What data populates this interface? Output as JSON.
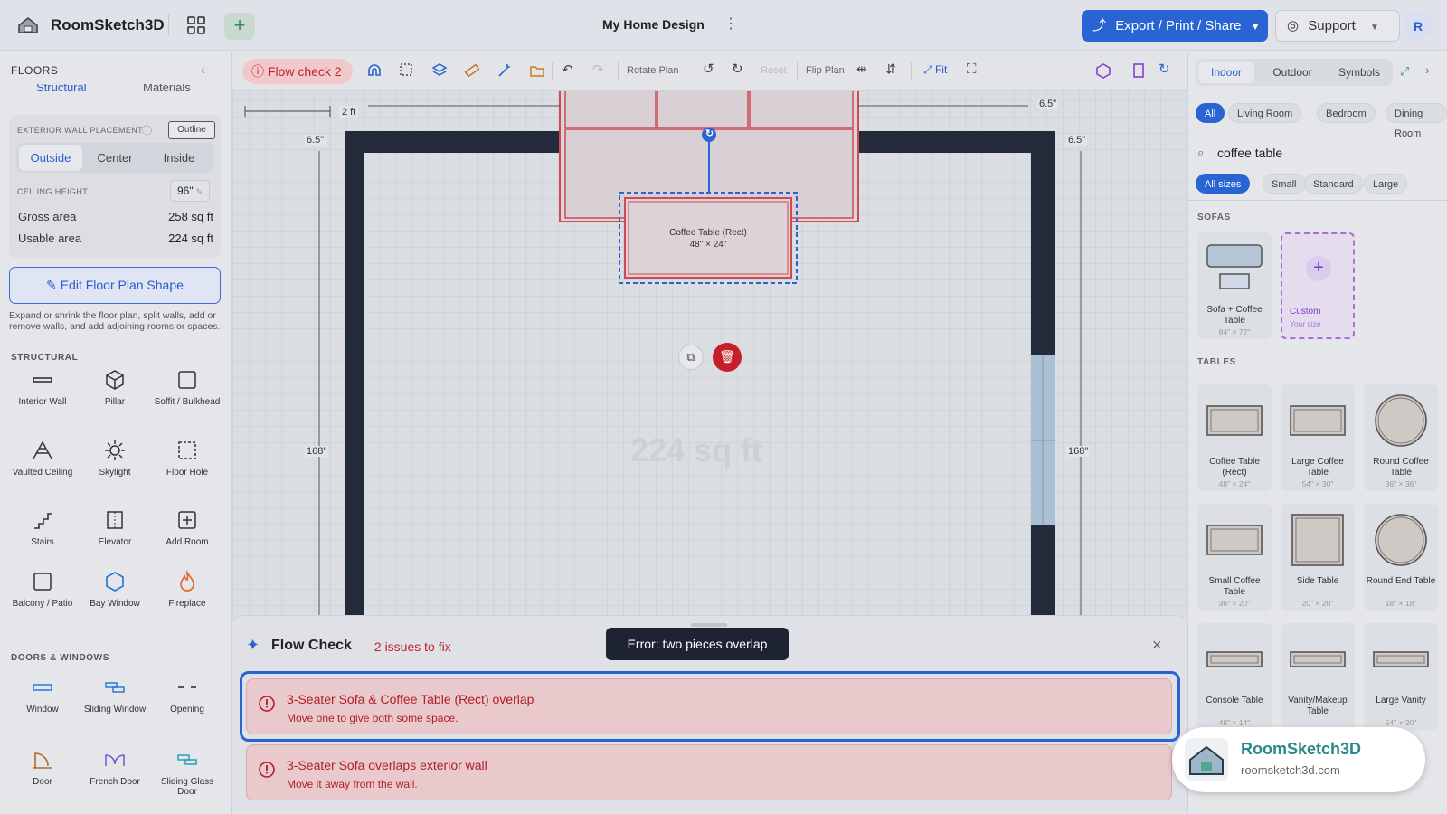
{
  "app": {
    "name": "RoomSketch3D",
    "doc_title": "My Home Design",
    "export_label": "Export / Print / Share",
    "support_label": "Support",
    "avatar_letter": "R"
  },
  "left": {
    "header": "FLOORS",
    "tabs": [
      "Structural",
      "Materials"
    ],
    "wall_placement_label": "EXTERIOR WALL PLACEMENT",
    "outline_label": "Outline",
    "placement_options": [
      "Outside",
      "Center",
      "Inside"
    ],
    "placement_selected": "Outside",
    "ceiling_label": "CEILING HEIGHT",
    "ceiling_value": "96\"",
    "gross_label": "Gross area",
    "gross_value": "258 sq ft",
    "usable_label": "Usable area",
    "usable_value": "224 sq ft",
    "edit_shape_label": "Edit Floor Plan Shape",
    "edit_hint": "Expand or shrink the floor plan, split walls, add or remove walls, and add adjoining rooms or spaces.",
    "structural_header": "STRUCTURAL",
    "structural_tools": [
      "Interior Wall",
      "Pillar",
      "Soffit / Bulkhead",
      "Vaulted Ceiling",
      "Skylight",
      "Floor Hole",
      "Stairs",
      "Elevator",
      "Add Room",
      "Balcony / Patio",
      "Bay Window",
      "Fireplace"
    ],
    "doors_header": "DOORS & WINDOWS",
    "door_tools": [
      "Window",
      "Sliding Window",
      "Opening",
      "Door",
      "French Door",
      "Sliding Glass Door"
    ]
  },
  "toolbar": {
    "flow_check": "Flow check 2",
    "rotate_label": "Rotate Plan",
    "reset_label": "Reset",
    "flip_label": "Flip Plan",
    "fit_label": "Fit"
  },
  "canvas": {
    "scale_label": "2 ft",
    "dim_top_left": "6.5\"",
    "dim_top_right": "6.5\"",
    "dim_corner_left": "6.5\"",
    "dim_corner_right": "6.5\"",
    "dim_left": "168\"",
    "dim_right": "168\"",
    "area_watermark": "224 sq ft",
    "selected_item_name": "Coffee Table (Rect)",
    "selected_item_size": "48\" × 24\""
  },
  "right": {
    "tabs": [
      "Indoor",
      "Outdoor",
      "Symbols"
    ],
    "tab_selected": "Indoor",
    "room_chips": [
      "All",
      "Living Room",
      "Bedroom",
      "Dining Room"
    ],
    "search_value": "coffee table",
    "size_chips": [
      "All sizes",
      "Small",
      "Standard",
      "Large"
    ],
    "sofas_header": "SOFAS",
    "sofa_item": {
      "name": "Sofa + Coffee Table",
      "size": "84\" × 72\""
    },
    "custom_item": {
      "name": "Custom",
      "sub": "Your size"
    },
    "tables_header": "TABLES",
    "tables": [
      {
        "name": "Coffee Table (Rect)",
        "size": "48\" × 24\""
      },
      {
        "name": "Large Coffee Table",
        "size": "54\" × 30\""
      },
      {
        "name": "Round Coffee Table",
        "size": "36\" × 36\""
      },
      {
        "name": "Small Coffee Table",
        "size": "36\" × 20\""
      },
      {
        "name": "Side Table",
        "size": "20\" × 20\""
      },
      {
        "name": "Round End Table",
        "size": "18\" × 18\""
      },
      {
        "name": "Console Table",
        "size": "48\" × 14\""
      },
      {
        "name": "Vanity/Makeup Table",
        "size": ""
      },
      {
        "name": "Large Vanity",
        "size": "54\" × 20\""
      }
    ]
  },
  "flow_check": {
    "title": "Flow Check",
    "count": "— 2 issues to fix",
    "issues": [
      {
        "title": "3-Seater Sofa & Coffee Table (Rect) overlap",
        "hint": "Move one to give both some space."
      },
      {
        "title": "3-Seater Sofa overlaps exterior wall",
        "hint": "Move it away from the wall."
      }
    ],
    "tooltip": "Error: two pieces overlap"
  },
  "badge": {
    "name": "RoomSketch3D",
    "url": "roomsketch3d.com"
  }
}
